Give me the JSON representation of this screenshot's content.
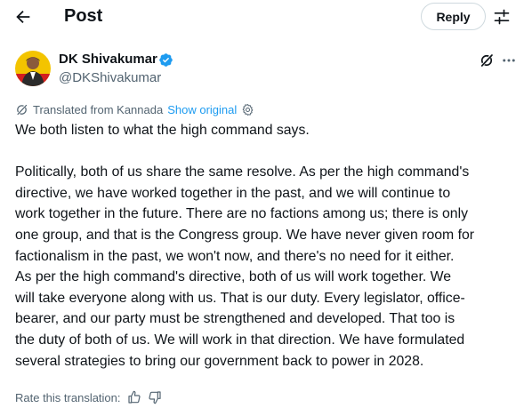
{
  "header": {
    "title": "Post",
    "reply_label": "Reply"
  },
  "author": {
    "name": "DK Shivakumar",
    "handle": "@DKShivakumar"
  },
  "translation": {
    "label": "Translated from Kannada",
    "show_original": "Show original"
  },
  "post": {
    "lines": [
      "We both listen to what the high command says.",
      "",
      "Politically, both of us share the same resolve. As per the high command's",
      "directive, we have worked together in the past, and we will continue to",
      "work together in the future. There are no factions among us; there is only",
      "one group, and that is the Congress group. We have never given room for",
      "factionalism in the past, we won't now, and there's no need for it either.",
      "As per the high command's directive, both of us will work together. We",
      "will take everyone along with us. That is our duty. Every legislator, office-",
      "bearer, and our party must be strengthened and developed. That too is",
      "the duty of both of us. We will work in that direction. We have formulated",
      "several strategies to bring our government back to power in 2028."
    ]
  },
  "rating": {
    "label": "Rate this translation:"
  },
  "icons": {
    "back": "arrow-left-icon",
    "adjust": "sliders-icon",
    "verified": "verified-badge-icon",
    "grok": "grok-icon",
    "more": "more-horizontal-icon",
    "translate": "translate-icon",
    "settings": "gear-icon",
    "thumbs_up": "thumbs-up-icon",
    "thumbs_down": "thumbs-down-icon"
  },
  "colors": {
    "text": "#0f1419",
    "secondary": "#536471",
    "accent": "#1d9bf0",
    "border": "#cfd9de"
  }
}
